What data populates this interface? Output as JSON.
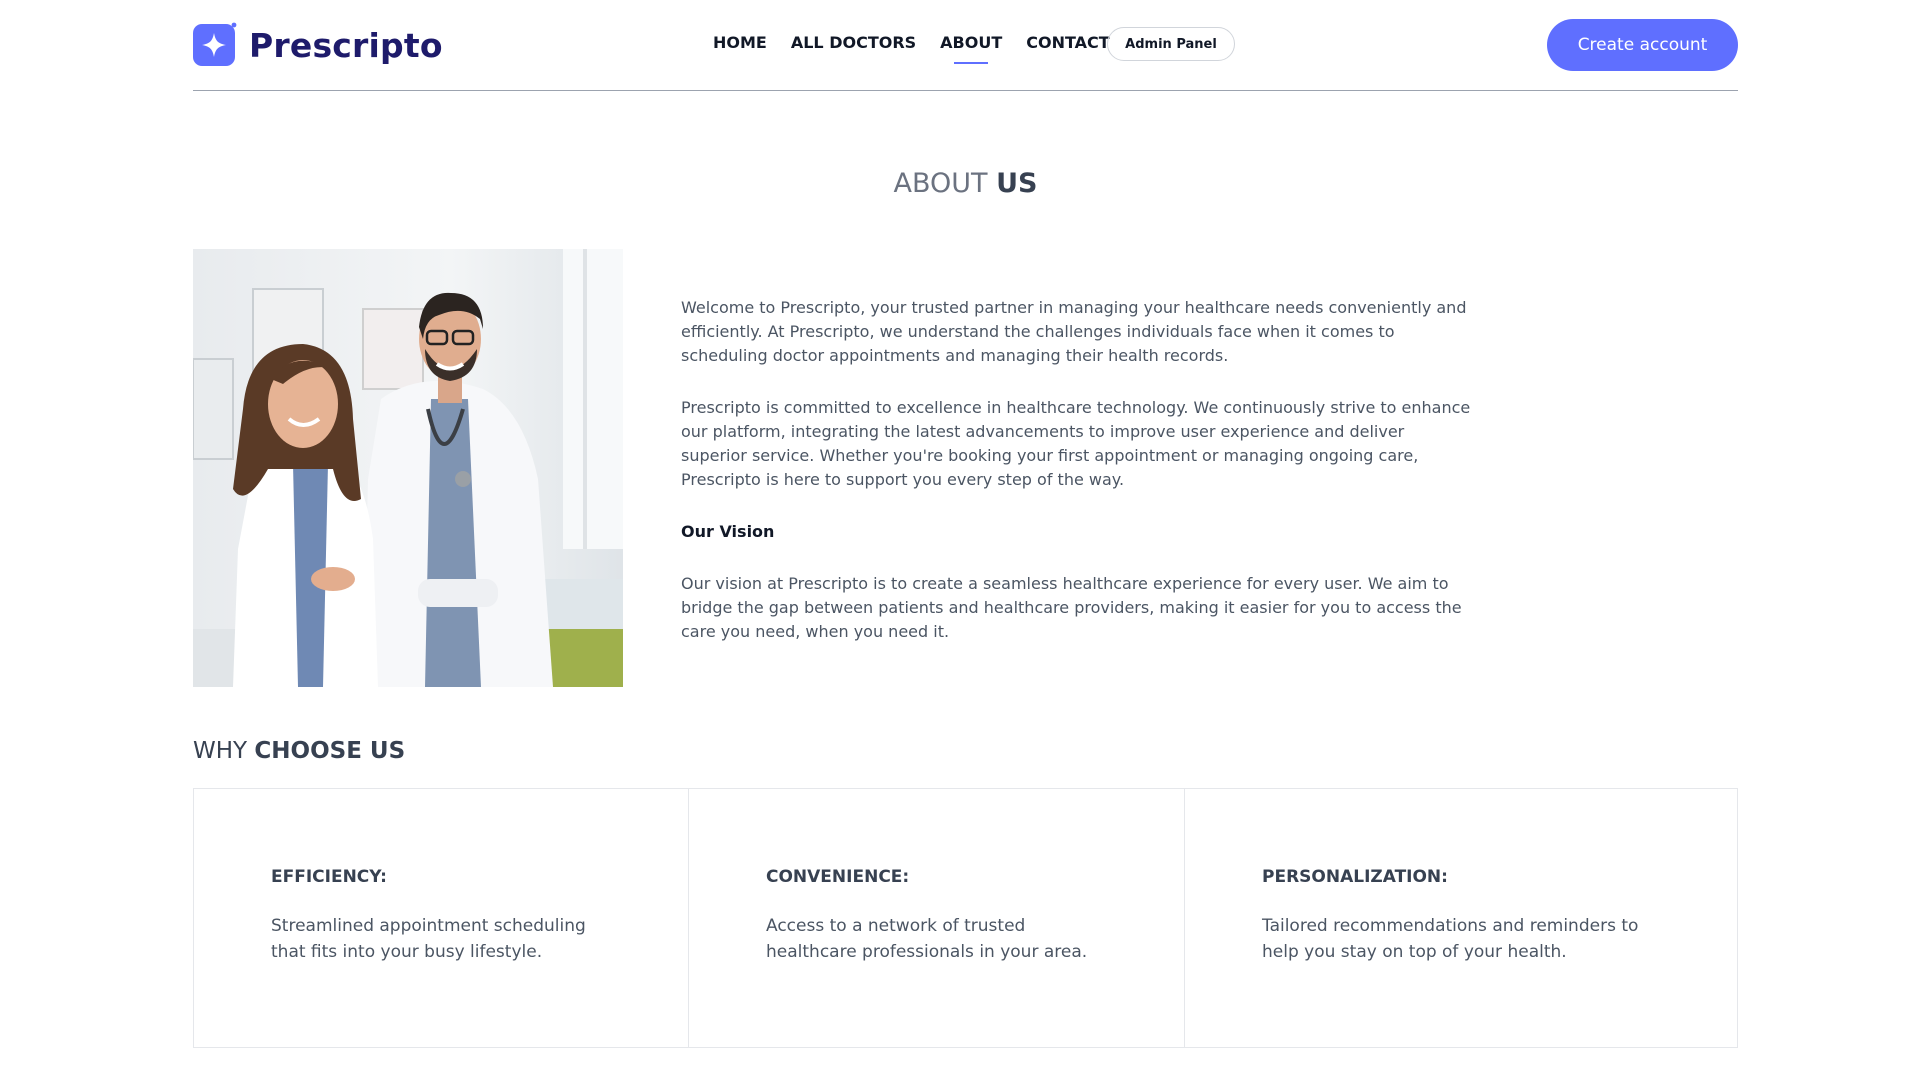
{
  "brand": {
    "name": "Prescripto",
    "color": "#5f6fff",
    "logo_icon": "star-sparkle-icon"
  },
  "nav": {
    "links": [
      {
        "label": "HOME"
      },
      {
        "label": "ALL DOCTORS"
      },
      {
        "label": "ABOUT",
        "active": true
      },
      {
        "label": "CONTACT"
      }
    ],
    "admin_label": "Admin Panel",
    "create_account_label": "Create account"
  },
  "about": {
    "title_light": "ABOUT",
    "title_bold": "US",
    "image_alt": "Two smiling doctors in white coats",
    "paragraph_1": "Welcome to Prescripto, your trusted partner in managing your healthcare needs conveniently and efficiently. At Prescripto, we understand the challenges individuals face when it comes to scheduling doctor appointments and managing their health records.",
    "paragraph_2": "Prescripto is committed to excellence in healthcare technology. We continuously strive to enhance our platform, integrating the latest advancements to improve user experience and deliver superior service. Whether you're booking your first appointment or managing ongoing care, Prescripto is here to support you every step of the way.",
    "vision_heading": "Our Vision",
    "vision_text": "Our vision at Prescripto is to create a seamless healthcare experience for every user. We aim to bridge the gap between patients and healthcare providers, making it easier for you to access the care you need, when you need it."
  },
  "why": {
    "title_light": "WHY",
    "title_bold": "CHOOSE US",
    "cards": [
      {
        "title": "EFFICIENCY:",
        "desc": "Streamlined appointment scheduling that fits into your busy lifestyle."
      },
      {
        "title": "CONVENIENCE:",
        "desc": "Access to a network of trusted healthcare professionals in your area."
      },
      {
        "title": "PERSONALIZATION:",
        "desc": "Tailored recommendations and reminders to help you stay on top of your health."
      }
    ]
  }
}
